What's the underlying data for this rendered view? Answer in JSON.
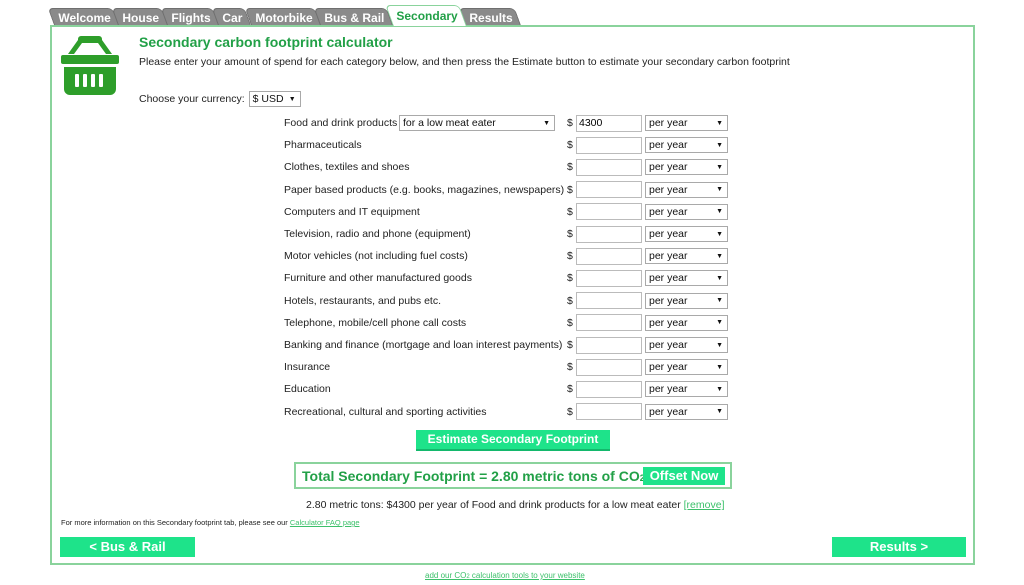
{
  "tabs": [
    {
      "label": "Welcome",
      "active": false
    },
    {
      "label": "House",
      "active": false
    },
    {
      "label": "Flights",
      "active": false
    },
    {
      "label": "Car",
      "active": false
    },
    {
      "label": "Motorbike",
      "active": false
    },
    {
      "label": "Bus & Rail",
      "active": false
    },
    {
      "label": "Secondary",
      "active": true
    },
    {
      "label": "Results",
      "active": false
    }
  ],
  "header": {
    "icon": "shopping-basket-icon",
    "title": "Secondary carbon footprint calculator",
    "intro": "Please enter your amount of spend for each category below, and then press the Estimate button to estimate your secondary carbon footprint"
  },
  "currency": {
    "label": "Choose your currency:",
    "selected": "$ USD"
  },
  "categories": [
    {
      "label": "Food and drink products",
      "type_selected": "for a low meat eater",
      "currency_symbol": "$",
      "amount": "4300",
      "period": "per year"
    },
    {
      "label": "Pharmaceuticals",
      "currency_symbol": "$",
      "amount": "",
      "period": "per year"
    },
    {
      "label": "Clothes, textiles and shoes",
      "currency_symbol": "$",
      "amount": "",
      "period": "per year"
    },
    {
      "label": "Paper based products (e.g. books, magazines, newspapers)",
      "currency_symbol": "$",
      "amount": "",
      "period": "per year"
    },
    {
      "label": "Computers and IT equipment",
      "currency_symbol": "$",
      "amount": "",
      "period": "per year"
    },
    {
      "label": "Television, radio and phone (equipment)",
      "currency_symbol": "$",
      "amount": "",
      "period": "per year"
    },
    {
      "label": "Motor vehicles (not including fuel costs)",
      "currency_symbol": "$",
      "amount": "",
      "period": "per year"
    },
    {
      "label": "Furniture and other manufactured goods",
      "currency_symbol": "$",
      "amount": "",
      "period": "per year"
    },
    {
      "label": "Hotels, restaurants, and pubs etc.",
      "currency_symbol": "$",
      "amount": "",
      "period": "per year"
    },
    {
      "label": "Telephone, mobile/cell phone call costs",
      "currency_symbol": "$",
      "amount": "",
      "period": "per year"
    },
    {
      "label": "Banking and finance (mortgage and loan interest payments)",
      "currency_symbol": "$",
      "amount": "",
      "period": "per year"
    },
    {
      "label": "Insurance",
      "currency_symbol": "$",
      "amount": "",
      "period": "per year"
    },
    {
      "label": "Education",
      "currency_symbol": "$",
      "amount": "",
      "period": "per year"
    },
    {
      "label": "Recreational, cultural and sporting activities",
      "currency_symbol": "$",
      "amount": "",
      "period": "per year"
    }
  ],
  "actions": {
    "estimate_label": "Estimate Secondary Footprint",
    "offset_label": "Offset Now",
    "prev_label": "< Bus & Rail",
    "next_label": "Results >"
  },
  "result": {
    "total_prefix": "Total Secondary Footprint = 2.80 metric tons of CO",
    "total_sub": "2",
    "total_suffix": "e",
    "summary": "2.80 metric tons: $4300 per year of Food and drink products for a low meat eater",
    "remove_label": "[remove]"
  },
  "footer": {
    "faq_text": "For more information on this Secondary footprint tab, please see our",
    "faq_link": "Calculator FAQ page",
    "embed_prefix": "add our CO",
    "embed_sub": "2",
    "embed_suffix": " calculation tools to your website"
  },
  "colors": {
    "brand_green": "#22a047",
    "button_green": "#1ee38a",
    "border_green": "#8ad39c",
    "tab_gray": "#8a8a8a"
  }
}
